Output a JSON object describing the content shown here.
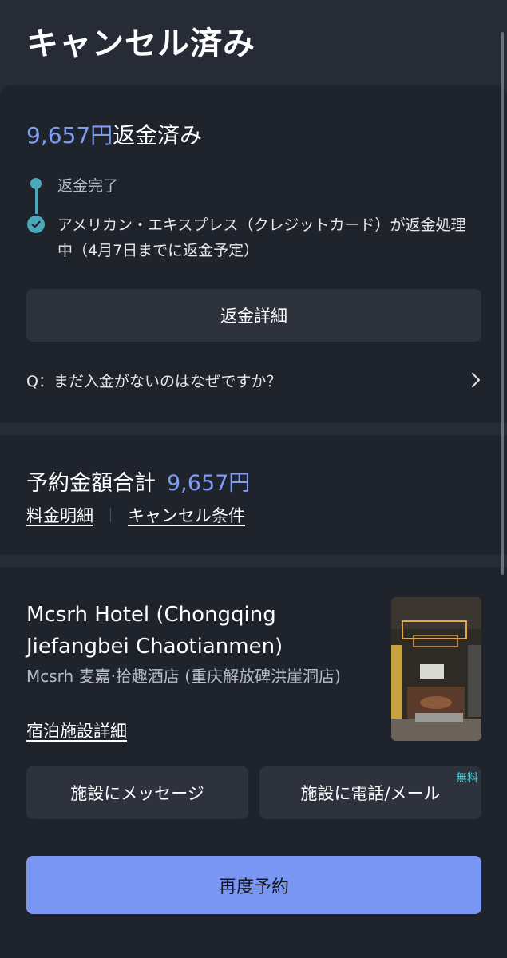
{
  "page_title": "キャンセル済み",
  "refund": {
    "amount": "9,657円",
    "status": "返金済み",
    "timeline": [
      {
        "text": "返金完了"
      },
      {
        "text": "アメリカン・エキスプレス（クレジットカード）が返金処理中（4月7日までに返金予定）"
      }
    ],
    "detail_button": "返金詳細",
    "faq_question": "Q：まだ入金がないのはなぜですか？"
  },
  "booking_total": {
    "label": "予約金額合計",
    "amount": "9,657円",
    "links": {
      "price_details": "料金明細",
      "cancel_policy": "キャンセル条件"
    }
  },
  "hotel": {
    "name": "Mcsrh Hotel (Chongqing Jiefangbei Chaotianmen)",
    "name_local": "Mcsrh 麦嘉·拾趣酒店 (重庆解放碑洪崖洞店)",
    "detail_link": "宿泊施設詳細",
    "message_button": "施設にメッセージ",
    "call_button": "施設に電話/メール",
    "call_badge": "無料",
    "rebook_button": "再度予約"
  },
  "colors": {
    "accent": "#7f9cf5",
    "timeline": "#4aa9b8",
    "badge": "#54c7cf",
    "background": "#262b36",
    "card": "#1f232c"
  }
}
